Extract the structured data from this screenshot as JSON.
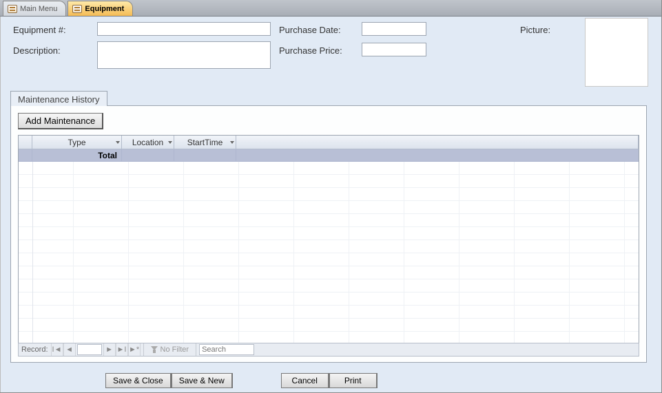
{
  "tabs": {
    "main_menu": "Main Menu",
    "equipment": "Equipment"
  },
  "fields": {
    "equipment_no_label": "Equipment #:",
    "description_label": "Description:",
    "purchase_date_label": "Purchase Date:",
    "purchase_price_label": "Purchase Price:",
    "picture_label": "Picture:",
    "equipment_no_value": "",
    "description_value": "",
    "purchase_date_value": "",
    "purchase_price_value": ""
  },
  "subtab": {
    "label": "Maintenance History",
    "add_button": "Add Maintenance",
    "columns": {
      "type": "Type",
      "location": "Location",
      "start_time": "StartTime"
    },
    "totals_label": "Total"
  },
  "recnav": {
    "record_label": "Record:",
    "no_filter": "No Filter",
    "search_placeholder": "Search"
  },
  "buttons": {
    "save_close": "Save & Close",
    "save_new": "Save & New",
    "cancel": "Cancel",
    "print": "Print"
  }
}
